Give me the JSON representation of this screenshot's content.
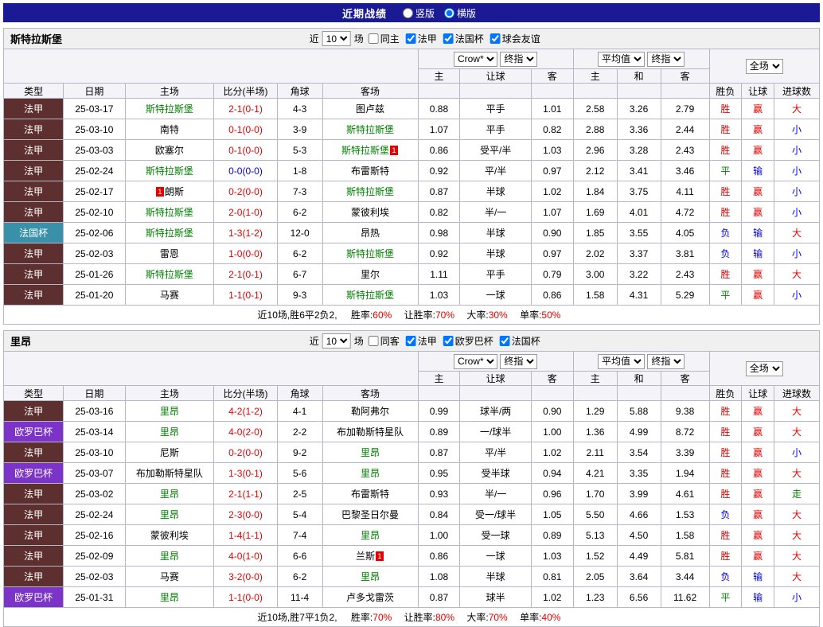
{
  "title_bar": {
    "title": "近期战绩",
    "vertical_label": "竖版",
    "horizontal_label": "横版",
    "vertical_checked": false,
    "horizontal_checked": true
  },
  "filter_labels": {
    "near": "近",
    "unit": "场"
  },
  "league_colors": {
    "法甲": "#5d2f2f",
    "法国杯": "#3a90a8",
    "欧罗巴杯": "#7b33c8"
  },
  "table_header": {
    "type": "类型",
    "date": "日期",
    "home": "主场",
    "score": "比分(半场)",
    "corner": "角球",
    "away": "客场",
    "asian_select": "Crow*",
    "asian_final": "终指",
    "euro_select": "平均值",
    "euro_final": "终指",
    "full_select": "全场",
    "asian_cols": [
      "主",
      "让球",
      "客"
    ],
    "euro_cols": [
      "主",
      "和",
      "客"
    ],
    "result_cols": [
      "胜负",
      "让球",
      "进球数"
    ]
  },
  "tables": [
    {
      "team": "斯特拉斯堡",
      "filter": {
        "count": "10",
        "same_label": "同主",
        "same_checked": false,
        "leagues": [
          {
            "label": "法甲",
            "checked": true
          },
          {
            "label": "法国杯",
            "checked": true
          },
          {
            "label": "球会友谊",
            "checked": true
          }
        ]
      },
      "rows": [
        {
          "league": "法甲",
          "date": "25-03-17",
          "home": {
            "name": "斯特拉斯堡",
            "green": true
          },
          "score": {
            "text": "2-1(0-1)",
            "cls": "red"
          },
          "corner": "4-3",
          "away": {
            "name": "图卢兹"
          },
          "asian": [
            "0.88",
            "平手",
            "1.01"
          ],
          "euro": [
            "2.58",
            "3.26",
            "2.79"
          ],
          "results": [
            [
              "胜",
              "red"
            ],
            [
              "赢",
              "red"
            ],
            [
              "大",
              "red"
            ]
          ]
        },
        {
          "league": "法甲",
          "date": "25-03-10",
          "home": {
            "name": "南特"
          },
          "score": {
            "text": "0-1(0-0)",
            "cls": "red"
          },
          "corner": "3-9",
          "away": {
            "name": "斯特拉斯堡",
            "green": true
          },
          "asian": [
            "1.07",
            "平手",
            "0.82"
          ],
          "euro": [
            "2.88",
            "3.36",
            "2.44"
          ],
          "results": [
            [
              "胜",
              "red"
            ],
            [
              "赢",
              "red"
            ],
            [
              "小",
              "blue"
            ]
          ]
        },
        {
          "league": "法甲",
          "date": "25-03-03",
          "home": {
            "name": "欧塞尔"
          },
          "score": {
            "text": "0-1(0-0)",
            "cls": "red"
          },
          "corner": "5-3",
          "away": {
            "name": "斯特拉斯堡",
            "green": true,
            "card": "1",
            "card_pos": "after"
          },
          "asian": [
            "0.86",
            "受平/半",
            "1.03"
          ],
          "euro": [
            "2.96",
            "3.28",
            "2.43"
          ],
          "results": [
            [
              "胜",
              "red"
            ],
            [
              "赢",
              "red"
            ],
            [
              "小",
              "blue"
            ]
          ]
        },
        {
          "league": "法甲",
          "date": "25-02-24",
          "home": {
            "name": "斯特拉斯堡",
            "green": true
          },
          "score": {
            "text": "0-0(0-0)",
            "cls": "blue"
          },
          "corner": "1-8",
          "away": {
            "name": "布雷斯特"
          },
          "asian": [
            "0.92",
            "平/半",
            "0.97"
          ],
          "euro": [
            "2.12",
            "3.41",
            "3.46"
          ],
          "results": [
            [
              "平",
              "green"
            ],
            [
              "输",
              "blue"
            ],
            [
              "小",
              "blue"
            ]
          ]
        },
        {
          "league": "法甲",
          "date": "25-02-17",
          "home": {
            "name": "朗斯",
            "card": "1",
            "card_pos": "before"
          },
          "score": {
            "text": "0-2(0-0)",
            "cls": "red"
          },
          "corner": "7-3",
          "away": {
            "name": "斯特拉斯堡",
            "green": true
          },
          "asian": [
            "0.87",
            "半球",
            "1.02"
          ],
          "euro": [
            "1.84",
            "3.75",
            "4.11"
          ],
          "results": [
            [
              "胜",
              "red"
            ],
            [
              "赢",
              "red"
            ],
            [
              "小",
              "blue"
            ]
          ]
        },
        {
          "league": "法甲",
          "date": "25-02-10",
          "home": {
            "name": "斯特拉斯堡",
            "green": true
          },
          "score": {
            "text": "2-0(1-0)",
            "cls": "red"
          },
          "corner": "6-2",
          "away": {
            "name": "蒙彼利埃"
          },
          "asian": [
            "0.82",
            "半/一",
            "1.07"
          ],
          "euro": [
            "1.69",
            "4.01",
            "4.72"
          ],
          "results": [
            [
              "胜",
              "red"
            ],
            [
              "赢",
              "red"
            ],
            [
              "小",
              "blue"
            ]
          ]
        },
        {
          "league": "法国杯",
          "date": "25-02-06",
          "home": {
            "name": "斯特拉斯堡",
            "green": true
          },
          "score": {
            "text": "1-3(1-2)",
            "cls": "red"
          },
          "corner": "12-0",
          "away": {
            "name": "昂热"
          },
          "asian": [
            "0.98",
            "半球",
            "0.90"
          ],
          "euro": [
            "1.85",
            "3.55",
            "4.05"
          ],
          "results": [
            [
              "负",
              "blue"
            ],
            [
              "输",
              "blue"
            ],
            [
              "大",
              "red"
            ]
          ]
        },
        {
          "league": "法甲",
          "date": "25-02-03",
          "home": {
            "name": "雷恩"
          },
          "score": {
            "text": "1-0(0-0)",
            "cls": "red"
          },
          "corner": "6-2",
          "away": {
            "name": "斯特拉斯堡",
            "green": true
          },
          "asian": [
            "0.92",
            "半球",
            "0.97"
          ],
          "euro": [
            "2.02",
            "3.37",
            "3.81"
          ],
          "results": [
            [
              "负",
              "blue"
            ],
            [
              "输",
              "blue"
            ],
            [
              "小",
              "blue"
            ]
          ]
        },
        {
          "league": "法甲",
          "date": "25-01-26",
          "home": {
            "name": "斯特拉斯堡",
            "green": true
          },
          "score": {
            "text": "2-1(0-1)",
            "cls": "red"
          },
          "corner": "6-7",
          "away": {
            "name": "里尔"
          },
          "asian": [
            "1.11",
            "平手",
            "0.79"
          ],
          "euro": [
            "3.00",
            "3.22",
            "2.43"
          ],
          "results": [
            [
              "胜",
              "red"
            ],
            [
              "赢",
              "red"
            ],
            [
              "大",
              "red"
            ]
          ]
        },
        {
          "league": "法甲",
          "date": "25-01-20",
          "home": {
            "name": "马赛"
          },
          "score": {
            "text": "1-1(0-1)",
            "cls": "red"
          },
          "corner": "9-3",
          "away": {
            "name": "斯特拉斯堡",
            "green": true
          },
          "asian": [
            "1.03",
            "一球",
            "0.86"
          ],
          "euro": [
            "1.58",
            "4.31",
            "5.29"
          ],
          "results": [
            [
              "平",
              "green"
            ],
            [
              "赢",
              "red"
            ],
            [
              "小",
              "blue"
            ]
          ]
        }
      ],
      "summary": {
        "prefix": "近10场,胜6平2负2,",
        "items": [
          {
            "label": "胜率:",
            "value": "60%"
          },
          {
            "label": "让胜率:",
            "value": "70%"
          },
          {
            "label": "大率:",
            "value": "30%"
          },
          {
            "label": "单率:",
            "value": "50%"
          }
        ]
      }
    },
    {
      "team": "里昂",
      "filter": {
        "count": "10",
        "same_label": "同客",
        "same_checked": false,
        "leagues": [
          {
            "label": "法甲",
            "checked": true
          },
          {
            "label": "欧罗巴杯",
            "checked": true
          },
          {
            "label": "法国杯",
            "checked": true
          }
        ]
      },
      "rows": [
        {
          "league": "法甲",
          "date": "25-03-16",
          "home": {
            "name": "里昂",
            "green": true
          },
          "score": {
            "text": "4-2(1-2)",
            "cls": "red"
          },
          "corner": "4-1",
          "away": {
            "name": "勒阿弗尔"
          },
          "asian": [
            "0.99",
            "球半/两",
            "0.90"
          ],
          "euro": [
            "1.29",
            "5.88",
            "9.38"
          ],
          "results": [
            [
              "胜",
              "red"
            ],
            [
              "赢",
              "red"
            ],
            [
              "大",
              "red"
            ]
          ]
        },
        {
          "league": "欧罗巴杯",
          "date": "25-03-14",
          "home": {
            "name": "里昂",
            "green": true
          },
          "score": {
            "text": "4-0(2-0)",
            "cls": "red"
          },
          "corner": "2-2",
          "away": {
            "name": "布加勒斯特星队"
          },
          "asian": [
            "0.89",
            "一/球半",
            "1.00"
          ],
          "euro": [
            "1.36",
            "4.99",
            "8.72"
          ],
          "results": [
            [
              "胜",
              "red"
            ],
            [
              "赢",
              "red"
            ],
            [
              "大",
              "red"
            ]
          ]
        },
        {
          "league": "法甲",
          "date": "25-03-10",
          "home": {
            "name": "尼斯"
          },
          "score": {
            "text": "0-2(0-0)",
            "cls": "red"
          },
          "corner": "9-2",
          "away": {
            "name": "里昂",
            "green": true
          },
          "asian": [
            "0.87",
            "平/半",
            "1.02"
          ],
          "euro": [
            "2.11",
            "3.54",
            "3.39"
          ],
          "results": [
            [
              "胜",
              "red"
            ],
            [
              "赢",
              "red"
            ],
            [
              "小",
              "blue"
            ]
          ]
        },
        {
          "league": "欧罗巴杯",
          "date": "25-03-07",
          "home": {
            "name": "布加勒斯特星队"
          },
          "score": {
            "text": "1-3(0-1)",
            "cls": "red"
          },
          "corner": "5-6",
          "away": {
            "name": "里昂",
            "green": true
          },
          "asian": [
            "0.95",
            "受半球",
            "0.94"
          ],
          "euro": [
            "4.21",
            "3.35",
            "1.94"
          ],
          "results": [
            [
              "胜",
              "red"
            ],
            [
              "赢",
              "red"
            ],
            [
              "大",
              "red"
            ]
          ]
        },
        {
          "league": "法甲",
          "date": "25-03-02",
          "home": {
            "name": "里昂",
            "green": true
          },
          "score": {
            "text": "2-1(1-1)",
            "cls": "red"
          },
          "corner": "2-5",
          "away": {
            "name": "布雷斯特"
          },
          "asian": [
            "0.93",
            "半/一",
            "0.96"
          ],
          "euro": [
            "1.70",
            "3.99",
            "4.61"
          ],
          "results": [
            [
              "胜",
              "red"
            ],
            [
              "赢",
              "red"
            ],
            [
              "走",
              "green"
            ]
          ]
        },
        {
          "league": "法甲",
          "date": "25-02-24",
          "home": {
            "name": "里昂",
            "green": true
          },
          "score": {
            "text": "2-3(0-0)",
            "cls": "red"
          },
          "corner": "5-4",
          "away": {
            "name": "巴黎圣日尔曼"
          },
          "asian": [
            "0.84",
            "受一/球半",
            "1.05"
          ],
          "euro": [
            "5.50",
            "4.66",
            "1.53"
          ],
          "results": [
            [
              "负",
              "blue"
            ],
            [
              "赢",
              "red"
            ],
            [
              "大",
              "red"
            ]
          ]
        },
        {
          "league": "法甲",
          "date": "25-02-16",
          "home": {
            "name": "蒙彼利埃"
          },
          "score": {
            "text": "1-4(1-1)",
            "cls": "red"
          },
          "corner": "7-4",
          "away": {
            "name": "里昂",
            "green": true
          },
          "asian": [
            "1.00",
            "受一球",
            "0.89"
          ],
          "euro": [
            "5.13",
            "4.50",
            "1.58"
          ],
          "results": [
            [
              "胜",
              "red"
            ],
            [
              "赢",
              "red"
            ],
            [
              "大",
              "red"
            ]
          ]
        },
        {
          "league": "法甲",
          "date": "25-02-09",
          "home": {
            "name": "里昂",
            "green": true
          },
          "score": {
            "text": "4-0(1-0)",
            "cls": "red"
          },
          "corner": "6-6",
          "away": {
            "name": "兰斯",
            "card": "1",
            "card_pos": "after"
          },
          "asian": [
            "0.86",
            "一球",
            "1.03"
          ],
          "euro": [
            "1.52",
            "4.49",
            "5.81"
          ],
          "results": [
            [
              "胜",
              "red"
            ],
            [
              "赢",
              "red"
            ],
            [
              "大",
              "red"
            ]
          ]
        },
        {
          "league": "法甲",
          "date": "25-02-03",
          "home": {
            "name": "马赛"
          },
          "score": {
            "text": "3-2(0-0)",
            "cls": "red"
          },
          "corner": "6-2",
          "away": {
            "name": "里昂",
            "green": true
          },
          "asian": [
            "1.08",
            "半球",
            "0.81"
          ],
          "euro": [
            "2.05",
            "3.64",
            "3.44"
          ],
          "results": [
            [
              "负",
              "blue"
            ],
            [
              "输",
              "blue"
            ],
            [
              "大",
              "red"
            ]
          ]
        },
        {
          "league": "欧罗巴杯",
          "date": "25-01-31",
          "home": {
            "name": "里昂",
            "green": true
          },
          "score": {
            "text": "1-1(0-0)",
            "cls": "red"
          },
          "corner": "11-4",
          "away": {
            "name": "卢多戈雷茨"
          },
          "asian": [
            "0.87",
            "球半",
            "1.02"
          ],
          "euro": [
            "1.23",
            "6.56",
            "11.62"
          ],
          "results": [
            [
              "平",
              "green"
            ],
            [
              "输",
              "blue"
            ],
            [
              "小",
              "blue"
            ]
          ]
        }
      ],
      "summary": {
        "prefix": "近10场,胜7平1负2,",
        "items": [
          {
            "label": "胜率:",
            "value": "70%"
          },
          {
            "label": "让胜率:",
            "value": "80%"
          },
          {
            "label": "大率:",
            "value": "70%"
          },
          {
            "label": "单率:",
            "value": "40%"
          }
        ]
      }
    }
  ]
}
